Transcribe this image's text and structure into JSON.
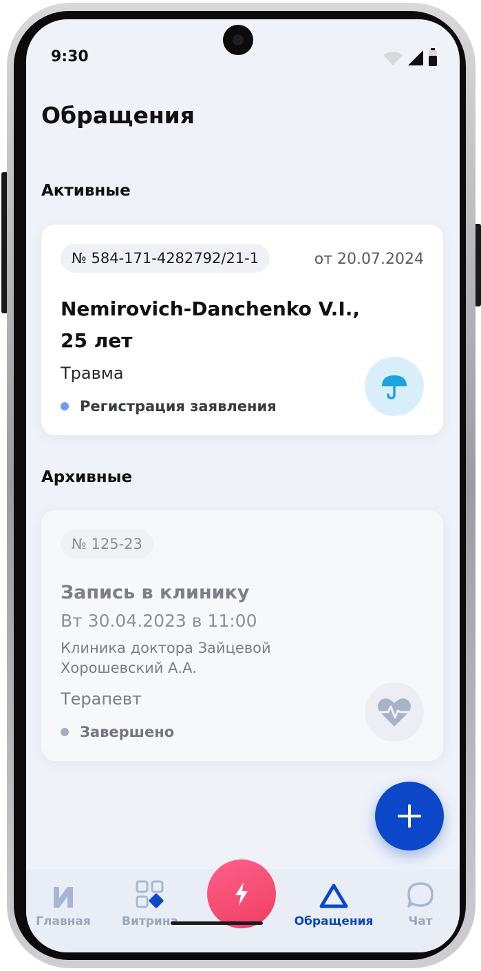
{
  "status_bar": {
    "time": "9:30"
  },
  "header": {
    "title": "Обращения"
  },
  "sections": {
    "active_title": "Активные",
    "archived_title": "Архивные"
  },
  "active_case": {
    "number": "№ 584-171-4282792/21-1",
    "date": "от 20.07.2024",
    "name": "Nemirovich-Danchenko V.I., 25 лет",
    "category": "Травма",
    "status": "Регистрация заявления",
    "status_color": "#6b9cf0",
    "icon": "umbrella-icon"
  },
  "archived_case": {
    "number": "№ 125-23",
    "title": "Запись в клинику",
    "datetime": "Вт 30.04.2023 в 11:00",
    "clinic": "Клиника доктора Зайцевой",
    "doctor": "Хорошевский А.А.",
    "category": "Терапевт",
    "status": "Завершено",
    "status_color": "#a3adc2",
    "icon": "heart-pulse-icon"
  },
  "fab": {
    "icon": "plus-icon"
  },
  "tabbar": {
    "items": [
      {
        "label": "Главная",
        "icon": "home-logo-icon"
      },
      {
        "label": "Витрина",
        "icon": "grid-icon"
      },
      {
        "label": "",
        "icon": "lightning-icon"
      },
      {
        "label": "Обращения",
        "icon": "triangle-icon",
        "active": true
      },
      {
        "label": "Чат",
        "icon": "chat-icon"
      }
    ]
  },
  "colors": {
    "accent": "#0b47c8",
    "center_button": "#f0446a",
    "background": "#eff2f8"
  }
}
